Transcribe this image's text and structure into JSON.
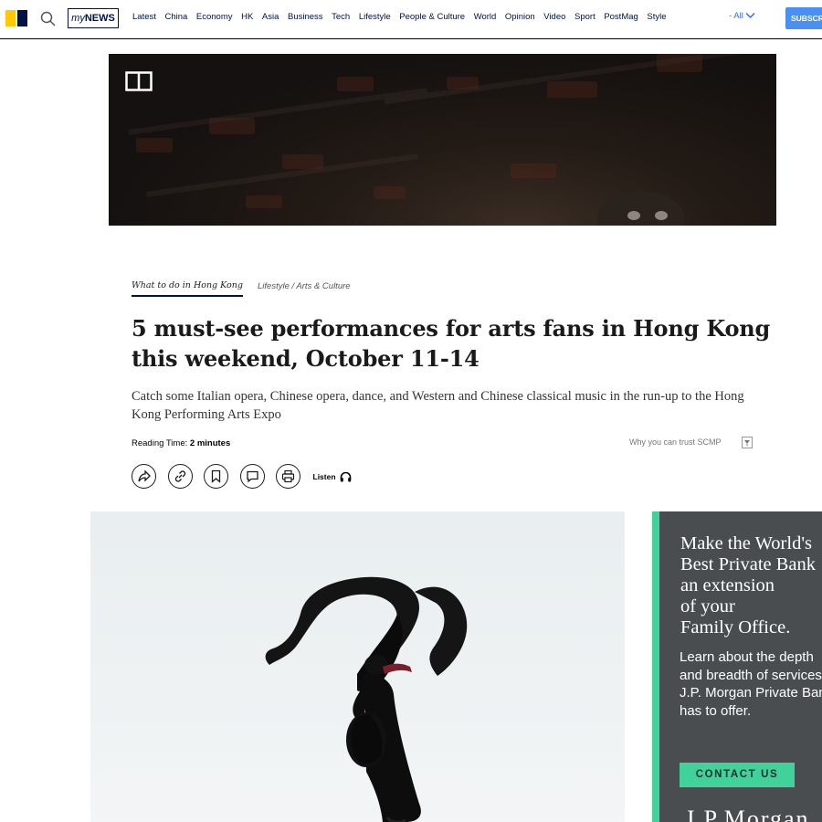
{
  "nav": {
    "logo_icon": "scmp-logo-icon",
    "search_icon": "search-icon",
    "mynews_prefix": "my",
    "mynews_label": "NEWS",
    "links": [
      "Latest",
      "China",
      "Economy",
      "HK",
      "Asia",
      "Business",
      "Tech",
      "Lifestyle",
      "People & Culture",
      "World",
      "Opinion",
      "Video",
      "Sport",
      "PostMag",
      "Style"
    ],
    "all_label": "- All",
    "subscribe_label": "SUBSCRIBE"
  },
  "hero": {
    "gallery_icon": "gallery-icon"
  },
  "article": {
    "section": "What to do in Hong Kong",
    "topics": "Lifestyle / Arts & Culture",
    "headline": "5 must-see performances for arts fans in Hong Kong this weekend, October 11-14",
    "subhead": "Catch some Italian opera, Chinese opera, dance, and Western and Chinese classical music in the run-up to the Hong Kong Performing Arts Expo",
    "reading_label": "Reading Time:",
    "reading_value": "2 minutes",
    "trust_label": "Why you can trust SCMP",
    "actions": [
      "share-icon",
      "link-icon",
      "bookmark-icon",
      "comment-icon",
      "print-icon"
    ],
    "listen_label": "Listen",
    "listen_icon": "headphones-icon"
  },
  "ad": {
    "headline_lines": [
      "Make the World's",
      "Best Private Bank",
      "an extension",
      "of your",
      "Family Office."
    ],
    "body_lines": [
      "Learn about the depth",
      "and breadth of services",
      "J.P. Morgan Private Bank",
      "has to offer."
    ],
    "cta_label": "CONTACT US",
    "brand": "J.P.Morgan",
    "accent_color": "#41d29c",
    "bg_color": "#4a4d50"
  }
}
